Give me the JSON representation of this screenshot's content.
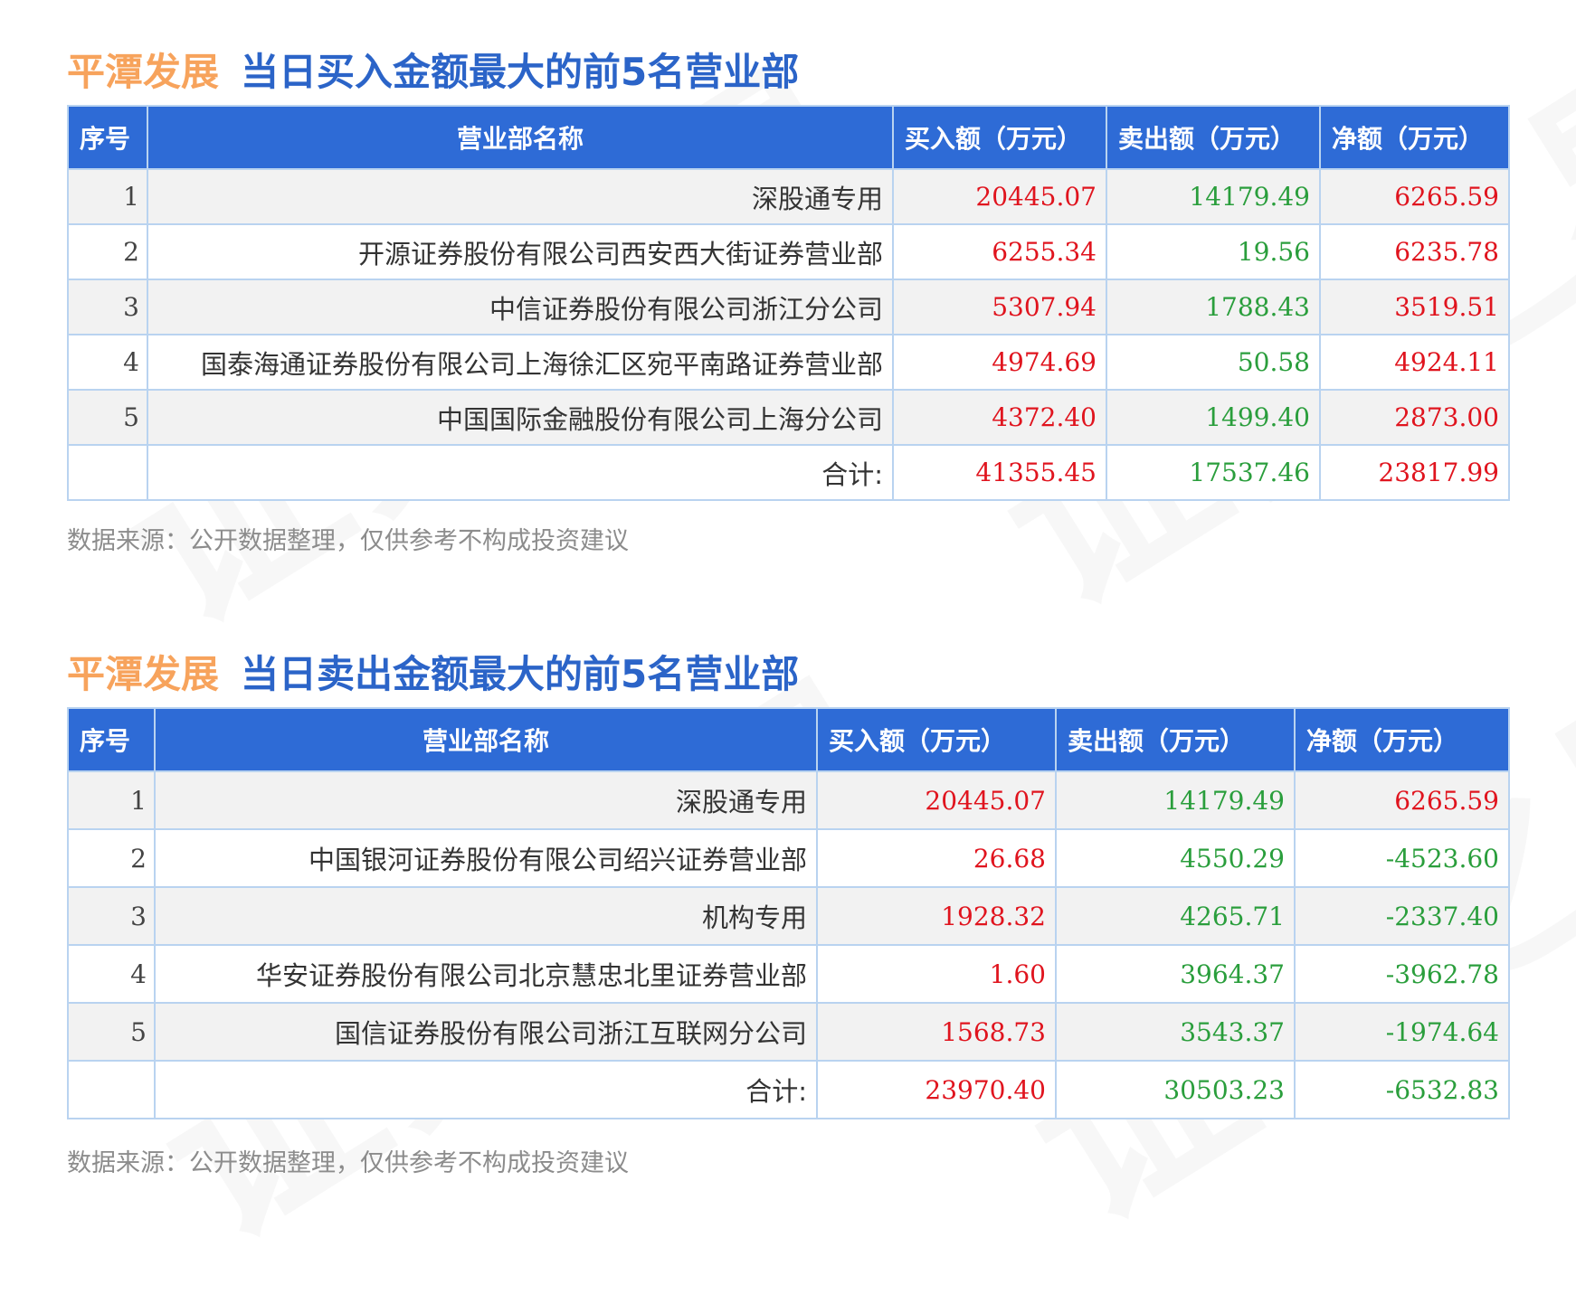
{
  "section1": {
    "stock_name": "平潭发展",
    "title": "当日买入金额最大的前5名营业部",
    "headers": [
      "序号",
      "营业部名称",
      "买入额（万元）",
      "卖出额（万元）",
      "净额（万元）"
    ],
    "rows": [
      {
        "idx": "1",
        "name": "深股通专用",
        "buy": "20445.07",
        "sell": "14179.49",
        "net": "6265.59"
      },
      {
        "idx": "2",
        "name": "开源证券股份有限公司西安西大街证券营业部",
        "buy": "6255.34",
        "sell": "19.56",
        "net": "6235.78"
      },
      {
        "idx": "3",
        "name": "中信证券股份有限公司浙江分公司",
        "buy": "5307.94",
        "sell": "1788.43",
        "net": "3519.51"
      },
      {
        "idx": "4",
        "name": "国泰海通证券股份有限公司上海徐汇区宛平南路证券营业部",
        "buy": "4974.69",
        "sell": "50.58",
        "net": "4924.11"
      },
      {
        "idx": "5",
        "name": "中国国际金融股份有限公司上海分公司",
        "buy": "4372.40",
        "sell": "1499.40",
        "net": "2873.00"
      }
    ],
    "total": {
      "label": "合计:",
      "buy": "41355.45",
      "sell": "17537.46",
      "net": "23817.99"
    },
    "source": "数据来源：公开数据整理，仅供参考不构成投资建议"
  },
  "section2": {
    "stock_name": "平潭发展",
    "title": "当日卖出金额最大的前5名营业部",
    "headers": [
      "序号",
      "营业部名称",
      "买入额（万元）",
      "卖出额（万元）",
      "净额（万元）"
    ],
    "rows": [
      {
        "idx": "1",
        "name": "深股通专用",
        "buy": "20445.07",
        "sell": "14179.49",
        "net": "6265.59"
      },
      {
        "idx": "2",
        "name": "中国银河证券股份有限公司绍兴证券营业部",
        "buy": "26.68",
        "sell": "4550.29",
        "net": "-4523.60"
      },
      {
        "idx": "3",
        "name": "机构专用",
        "buy": "1928.32",
        "sell": "4265.71",
        "net": "-2337.40"
      },
      {
        "idx": "4",
        "name": "华安证券股份有限公司北京慧忠北里证券营业部",
        "buy": "1.60",
        "sell": "3964.37",
        "net": "-3962.78"
      },
      {
        "idx": "5",
        "name": "国信证券股份有限公司浙江互联网分公司",
        "buy": "1568.73",
        "sell": "3543.37",
        "net": "-1974.64"
      }
    ],
    "total": {
      "label": "合计:",
      "buy": "23970.40",
      "sell": "30503.23",
      "net": "-6532.83"
    },
    "source": "数据来源：公开数据整理，仅供参考不构成投资建议"
  },
  "watermark": "证券之星",
  "colors": {
    "stock_name": "#f7a35c",
    "title": "#2b64c8",
    "header_bg": "#2e6bd6",
    "border": "#b9d3f0",
    "positive": "#e0141e",
    "negative": "#2a9e3c",
    "source": "#8c8c8c"
  }
}
